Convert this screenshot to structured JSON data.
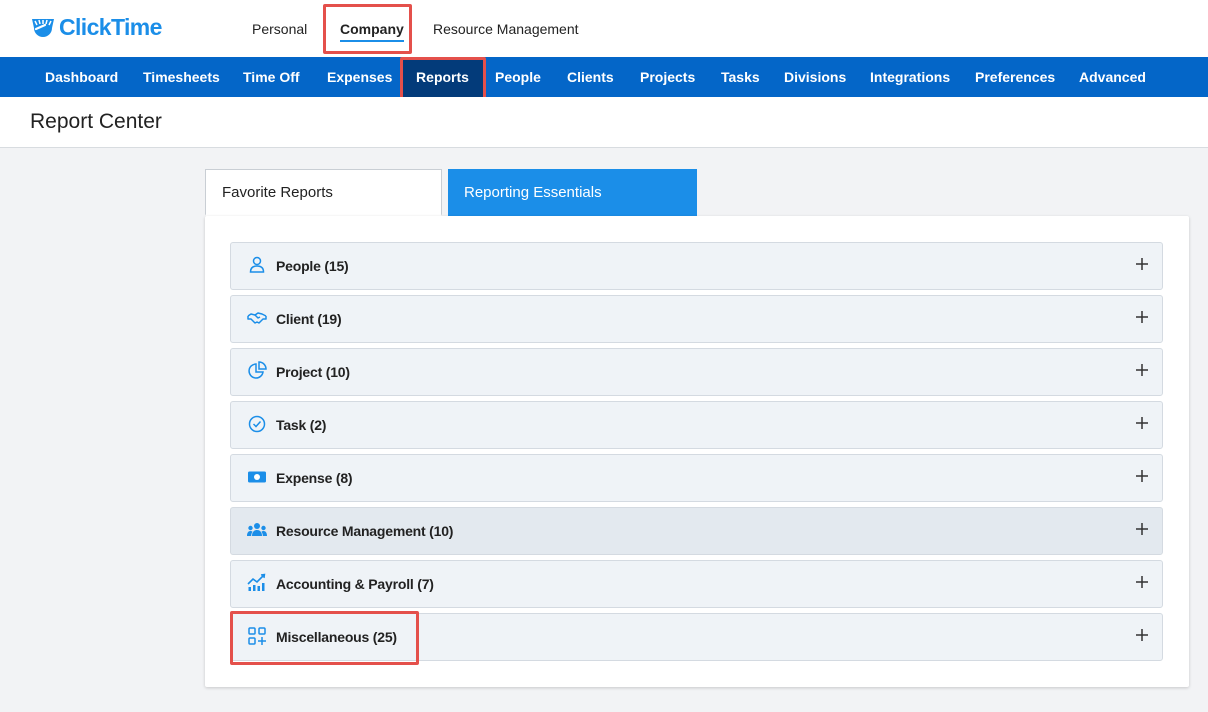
{
  "brand": {
    "name": "ClickTime",
    "color": "#1b8ee8"
  },
  "top_tabs": [
    {
      "label": "Personal",
      "active": false
    },
    {
      "label": "Company",
      "active": true
    },
    {
      "label": "Resource Management",
      "active": false
    }
  ],
  "nav": {
    "items": [
      {
        "label": "Dashboard"
      },
      {
        "label": "Timesheets"
      },
      {
        "label": "Time Off"
      },
      {
        "label": "Expenses"
      },
      {
        "label": "Reports",
        "active": true
      },
      {
        "label": "People"
      },
      {
        "label": "Clients"
      },
      {
        "label": "Projects"
      },
      {
        "label": "Tasks"
      },
      {
        "label": "Divisions"
      },
      {
        "label": "Integrations"
      },
      {
        "label": "Preferences"
      },
      {
        "label": "Advanced"
      }
    ],
    "background": "#0466c8",
    "active_background": "#033b7a"
  },
  "page": {
    "title": "Report Center"
  },
  "report_tabs": [
    {
      "label": "Favorite Reports",
      "active": false
    },
    {
      "label": "Reporting Essentials",
      "active": true
    }
  ],
  "categories": [
    {
      "label": "People (15)",
      "icon": "person-icon"
    },
    {
      "label": "Client (19)",
      "icon": "handshake-icon"
    },
    {
      "label": "Project (10)",
      "icon": "pie-chart-icon"
    },
    {
      "label": "Task (2)",
      "icon": "check-circle-icon"
    },
    {
      "label": "Expense (8)",
      "icon": "money-icon"
    },
    {
      "label": "Resource Management (10)",
      "icon": "team-icon"
    },
    {
      "label": "Accounting & Payroll (7)",
      "icon": "trend-chart-icon"
    },
    {
      "label": "Miscellaneous (25)",
      "icon": "apps-add-icon"
    }
  ],
  "colors": {
    "highlight": "#e4504b",
    "accent": "#1b8ee8"
  }
}
